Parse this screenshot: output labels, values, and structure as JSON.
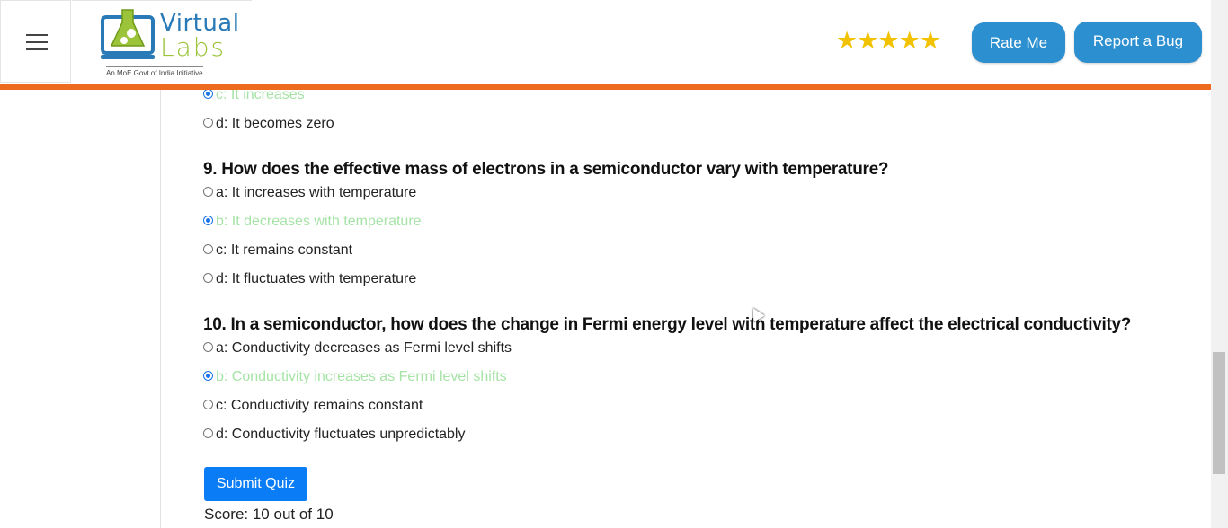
{
  "header": {
    "logo_top": "Virtual",
    "logo_bottom": "Labs",
    "logo_tagline": "An MoE Govt of India Initiative",
    "stars": "★★★★★",
    "rate_label": "Rate Me",
    "bug_label": "Report a Bug"
  },
  "quiz": {
    "q8_options": [
      {
        "text": "c: It increases",
        "selected": true,
        "correct": true
      },
      {
        "text": "d: It becomes zero",
        "selected": false,
        "correct": false
      }
    ],
    "q9": {
      "question": "9. How does the effective mass of electrons in a semiconductor vary with temperature?",
      "options": [
        {
          "text": "a: It increases with temperature"
        },
        {
          "text": "b: It decreases with temperature"
        },
        {
          "text": "c: It remains constant"
        },
        {
          "text": "d: It fluctuates with temperature"
        }
      ]
    },
    "q10": {
      "question": "10. In a semiconductor, how does the change in Fermi energy level with temperature affect the electrical conductivity?",
      "options": [
        {
          "text": "a: Conductivity decreases as Fermi level shifts"
        },
        {
          "text": "b: Conductivity increases as Fermi level shifts"
        },
        {
          "text": "c: Conductivity remains constant"
        },
        {
          "text": "d: Conductivity fluctuates unpredictably"
        }
      ]
    },
    "submit_label": "Submit Quiz",
    "score": "Score: 10 out of 10"
  },
  "colors": {
    "accent_bar": "#ed6a1f",
    "header_button": "#2c8fd0",
    "submit_button": "#0a7cf5",
    "correct_answer": "#a6e3a6",
    "stars": "#f2c200"
  }
}
